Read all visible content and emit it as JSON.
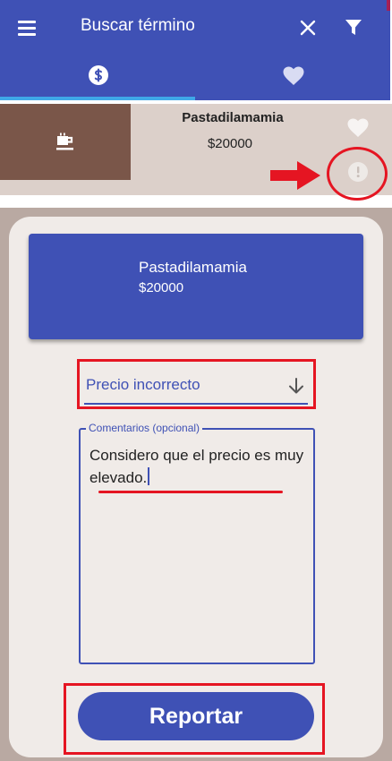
{
  "colors": {
    "primary": "#3f51b5",
    "tab_indicator": "#3fa8e8",
    "highlight_red": "#e51522",
    "thumb_brown": "#7a5649",
    "row_background": "#dcd0ca",
    "outer_background": "#b9a9a2",
    "card_background": "#f0ebe8"
  },
  "appbar": {
    "search_placeholder": "Buscar término",
    "menu_icon": "menu-icon",
    "close_icon": "close-icon",
    "filter_icon": "filter-icon"
  },
  "tabs": [
    {
      "icon": "dollar-icon",
      "selected": true
    },
    {
      "icon": "heart-icon",
      "selected": false
    }
  ],
  "product": {
    "name": "Pastadilamamia",
    "price": "$20000",
    "thumbnail_icon": "coffee-cup-icon",
    "favorite_icon": "heart-icon",
    "report_icon": "exclamation-icon"
  },
  "report_form": {
    "product_name": "Pastadilamamia",
    "product_price": "$20000",
    "reason": {
      "selected": "Precio incorrecto",
      "icon": "arrow-down-icon"
    },
    "comments": {
      "label": "Comentarios (opcional)",
      "value": "Considero que el precio es muy elevado."
    },
    "submit_label": "Reportar"
  }
}
